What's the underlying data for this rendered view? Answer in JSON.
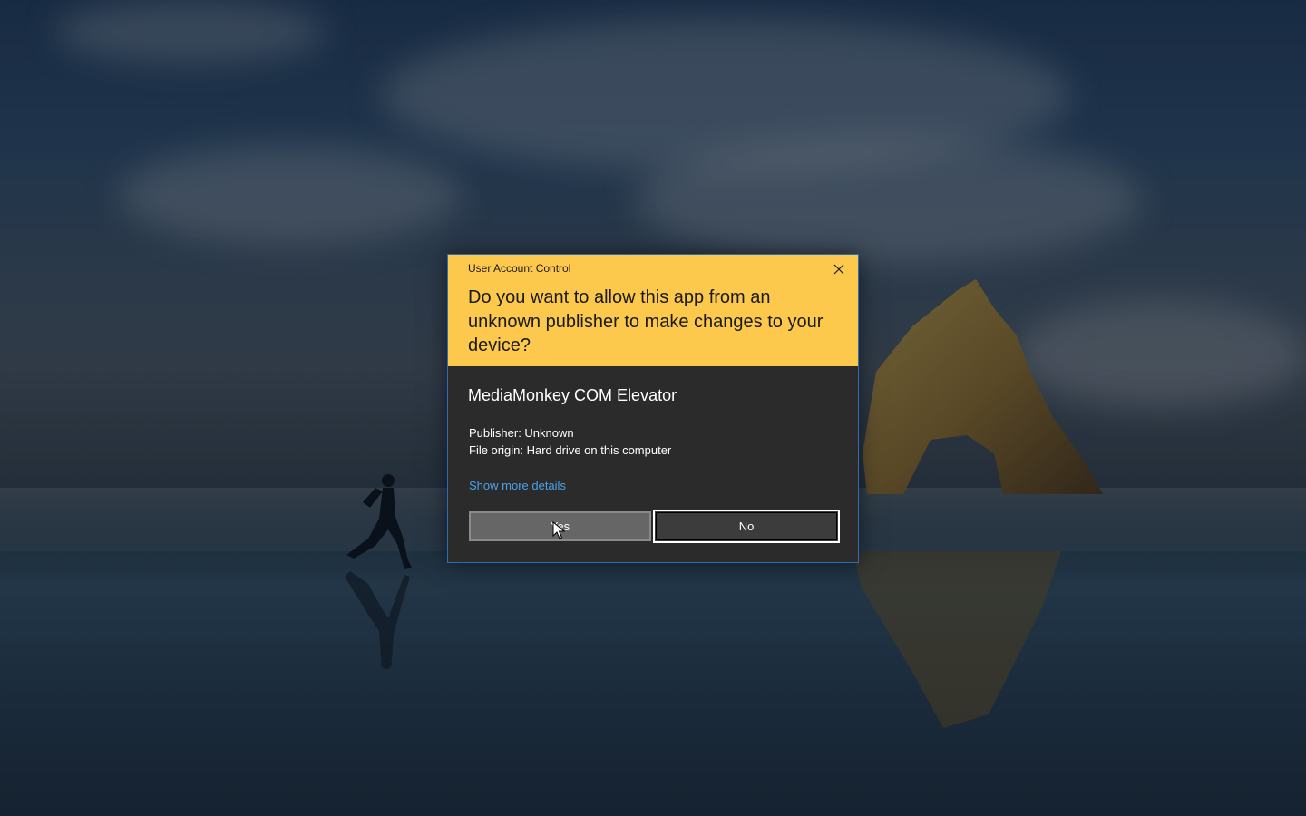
{
  "dialog": {
    "caption": "User Account Control",
    "question": "Do you want to allow this app from an unknown publisher to make changes to your device?",
    "app_name": "MediaMonkey COM Elevator",
    "publisher": "Publisher: Unknown",
    "file_origin": "File origin: Hard drive on this computer",
    "details_link": "Show more details",
    "yes_label": "Yes",
    "no_label": "No",
    "close_icon": "close-icon"
  },
  "colors": {
    "header_background": "#fcc94d",
    "body_background": "#2b2b2b",
    "dialog_border": "#2a6fb5",
    "link": "#4aa3ea",
    "yes_button": "#666666",
    "no_button": "#3c3c3c"
  },
  "desktop": {
    "wallpaper_icon": "beach-rock-runner-wallpaper"
  }
}
